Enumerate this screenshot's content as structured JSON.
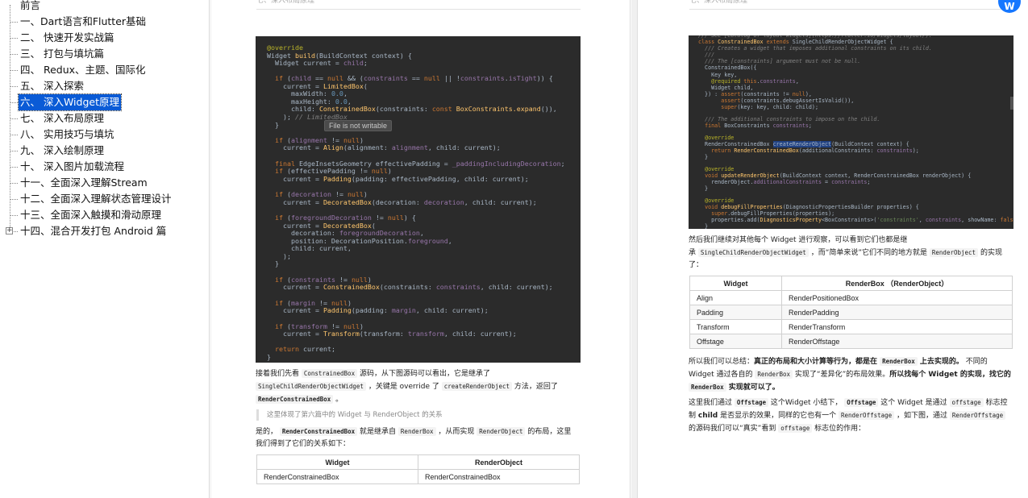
{
  "toc": {
    "items": [
      {
        "label": "前言"
      },
      {
        "label": "一、Dart语言和Flutter基础"
      },
      {
        "label": "二、 快速开发实战篇"
      },
      {
        "label": "三、 打包与填坑篇"
      },
      {
        "label": "四、 Redux、主题、国际化"
      },
      {
        "label": "五、 深入探索"
      },
      {
        "label": "六、 深入Widget原理"
      },
      {
        "label": "七、 深入布局原理"
      },
      {
        "label": "八、 实用技巧与填坑"
      },
      {
        "label": "九、 深入绘制原理"
      },
      {
        "label": "十、 深入图片加载流程"
      },
      {
        "label": "十一、全面深入理解Stream"
      },
      {
        "label": "十二、全面深入理解状态管理设计"
      },
      {
        "label": "十三、全面深入触摸和滑动原理"
      },
      {
        "label": "十四、混合开发打包 Android 篇"
      }
    ],
    "selected_index": 6,
    "expander_symbol": "+"
  },
  "page1": {
    "header": "七、深入布局原理",
    "tooltip": "File is not writable",
    "para1": {
      "t1": "接着我们先看 ",
      "c1": "ConstrainedBox",
      "t2": " 源码，从下图源码可以看出，它是继承了",
      "c2": "SingleChildRenderObjectWidget",
      "t3": " ，关键是 override 了 ",
      "c3": "createRenderObject",
      "t4": " 方法，返回了",
      "c4": "RenderConstrainedBox",
      "t5": " 。"
    },
    "quote": "这里体现了第六篇中的 Widget 与 RenderObject 的关系",
    "para2": {
      "t1": "是的， ",
      "c1": "RenderConstrainedBox",
      "t2": " 就是继承自 ",
      "c2": "RenderBox",
      "t3": " ，从而实现 ",
      "c3": "RenderObject",
      "t4": " 的布局，这里",
      "t5": "我们得到了它们的关系如下："
    },
    "table": {
      "headers": [
        "Widget",
        "RenderObject"
      ],
      "rows": [
        [
          "RenderConstrainedBox",
          "RenderConstrainedBox"
        ]
      ]
    }
  },
  "page2": {
    "header": "七、深入布局原理",
    "avatar": "W",
    "para1": {
      "t1": "然后我们继续对其他每个 Widget 进行观察，可以看到它们也都是继",
      "t2": "承 ",
      "c1": "SingleChildRenderObjectWidget",
      "t3": " ，而“简单来说”它们不同的地方就是 ",
      "c2": "RenderObject",
      "t4": " 的实现",
      "t5": "了："
    },
    "table": {
      "headers": [
        "Widget",
        "RenderBox （RenderObject）"
      ],
      "rows": [
        [
          "Align",
          "RenderPositionedBox"
        ],
        [
          "Padding",
          "RenderPadding"
        ],
        [
          "Transform",
          "RenderTransform"
        ],
        [
          "Offstage",
          "RenderOffstage"
        ]
      ]
    },
    "para2": {
      "t1": "所以我们可以总结：",
      "b1": "真正的布局和大小计算等行为，都是在 ",
      "c1": "RenderBox",
      "b2": " 上去实现的。",
      "t2": " 不同的",
      "t3": "Widget 通过各自的 ",
      "c2": "RenderBox",
      "t4": " 实现了“差异化”的布局效果。",
      "b3": "所以找每个 Widget 的实现，找它的",
      "c3": "RenderBox",
      "b4": " 实现就可以了。"
    },
    "para3": {
      "t1": "这里我们通过 ",
      "c1": "Offstage",
      "t2": " 这个Widget 小结下， ",
      "c2": "Offstage",
      "t3": " 这个 Widget 是通过 ",
      "c3": "offstage",
      "t4": " 标志控",
      "t5": "制 ",
      "b1": "child",
      "t6": " 是否显示的效果，同样的它也有一个 ",
      "c4": "RenderOffstage",
      "t7": " ，如下图，通过 ",
      "c5": "RenderOffstage",
      "t8": "的源码我们可以“真实”看到 ",
      "c6": "offstage",
      "t9": " 标志位的作用："
    }
  },
  "colors": {
    "selection": "#0a5bd6",
    "code_bg": "#2b2b2b",
    "keyword": "#cc7832",
    "function": "#ffc66d",
    "field": "#9876aa",
    "avatar": "#1677ff"
  }
}
